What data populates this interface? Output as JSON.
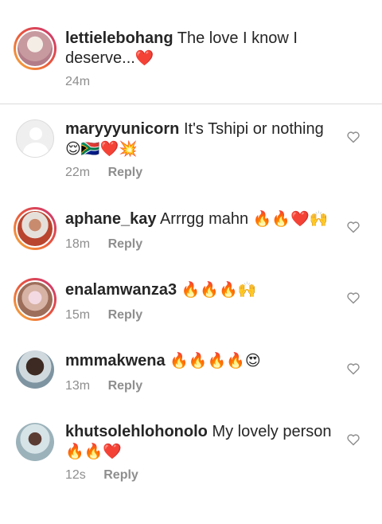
{
  "caption": {
    "username": "lettielebohang",
    "text": "The love I know I deserve...",
    "emoji": "❤️",
    "time": "24m"
  },
  "comments": [
    {
      "username": "maryyyunicorn",
      "text": "It's Tshipi or nothing",
      "emoji": "😌🇿🇦❤️💥",
      "time": "22m",
      "reply": "Reply"
    },
    {
      "username": "aphane_kay",
      "text": "Arrrgg mahn",
      "emoji": "🔥🔥❤️🙌",
      "time": "18m",
      "reply": "Reply"
    },
    {
      "username": "enalamwanza3",
      "text": "",
      "emoji": "🔥🔥🔥🙌",
      "time": "15m",
      "reply": "Reply"
    },
    {
      "username": "mmmakwena",
      "text": "",
      "emoji": "🔥🔥🔥🔥😍",
      "time": "13m",
      "reply": "Reply"
    },
    {
      "username": "khutsolehlohonolo",
      "text": "My lovely person",
      "emoji": "🔥🔥❤️",
      "time": "12s",
      "reply": "Reply"
    }
  ],
  "icons": {
    "like": "heart-outline-icon",
    "default_avatar": "default-avatar-icon"
  },
  "colors": {
    "text": "#262626",
    "meta": "#8e8e8e",
    "divider": "#dbdbdb",
    "story_ring_start": "#f9b33c",
    "story_ring_end": "#c83478"
  }
}
